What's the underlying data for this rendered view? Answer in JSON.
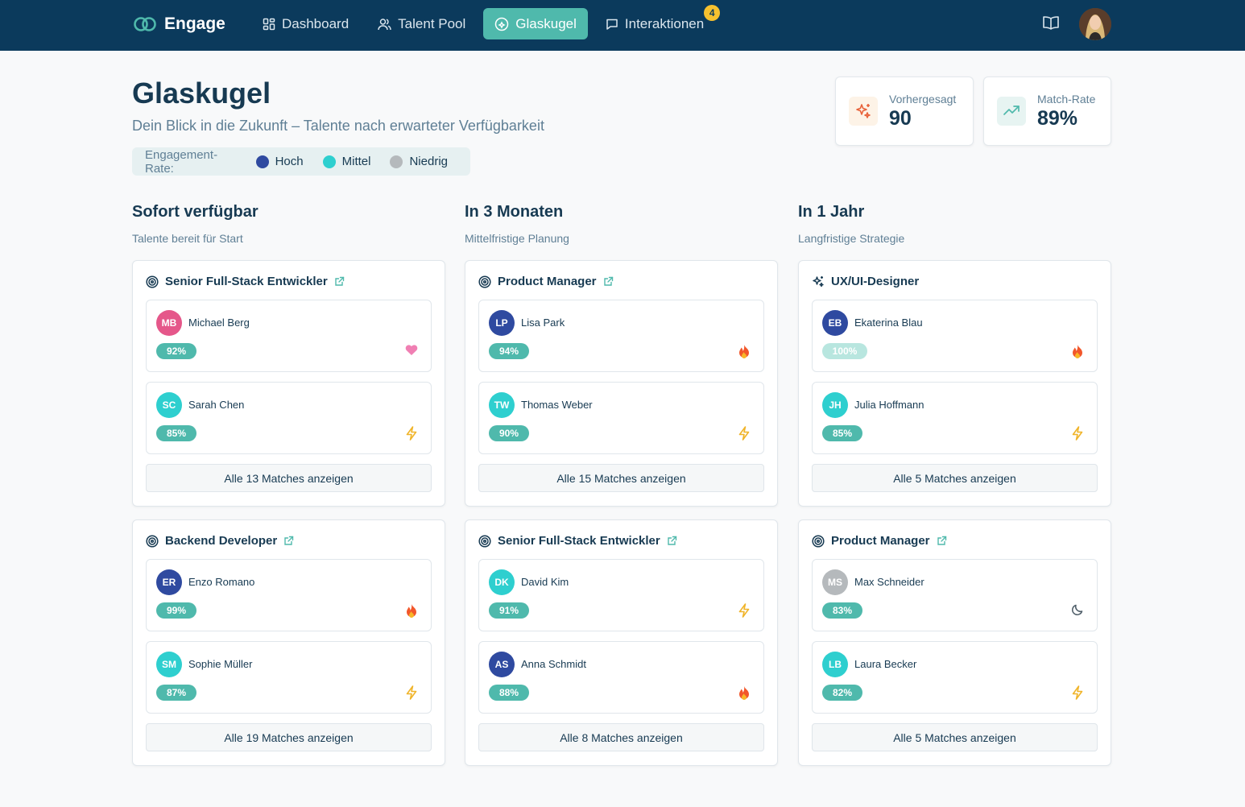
{
  "nav": {
    "brand": "Engage",
    "items": [
      {
        "label": "Dashboard",
        "icon": "grid-icon"
      },
      {
        "label": "Talent Pool",
        "icon": "users-icon"
      },
      {
        "label": "Glaskugel",
        "icon": "crystal-ball-icon",
        "active": true
      },
      {
        "label": "Interaktionen",
        "icon": "message-icon",
        "badge": "4"
      }
    ]
  },
  "header": {
    "title": "Glaskugel",
    "subtitle": "Dein Blick in die Zukunft – Talente nach erwarteter Verfügbarkeit",
    "legend": {
      "label": "Engagement-Rate:",
      "items": [
        {
          "label": "Hoch",
          "color": "#2f4aa0"
        },
        {
          "label": "Mittel",
          "color": "#2ecfcf"
        },
        {
          "label": "Niedrig",
          "color": "#b5b9bc"
        }
      ]
    }
  },
  "stats": [
    {
      "label": "Vorhergesagt",
      "value": "90",
      "icon": "sparkle-icon"
    },
    {
      "label": "Match-Rate",
      "value": "89%",
      "icon": "trending-up-icon"
    }
  ],
  "colors": {
    "high": "#2f4aa0",
    "mid": "#2ecfcf",
    "low": "#b5b9bc",
    "pink": "#e5578a",
    "accent": "#4fb9ac"
  },
  "columns": [
    {
      "title": "Sofort verfügbar",
      "subtitle": "Talente bereit für Start",
      "cards": [
        {
          "role": "Senior Full-Stack Entwickler",
          "icon": "target-icon",
          "link": true,
          "candidates": [
            {
              "initials": "MB",
              "name": "Michael Berg",
              "pct": "92%",
              "avatar": "pink",
              "indicator": "heart"
            },
            {
              "initials": "SC",
              "name": "Sarah Chen",
              "pct": "85%",
              "avatar": "mid",
              "indicator": "bolt"
            }
          ],
          "button": "Alle 13 Matches anzeigen"
        },
        {
          "role": "Backend Developer",
          "icon": "target-icon",
          "link": true,
          "candidates": [
            {
              "initials": "ER",
              "name": "Enzo Romano",
              "pct": "99%",
              "avatar": "high",
              "indicator": "flame"
            },
            {
              "initials": "SM",
              "name": "Sophie Müller",
              "pct": "87%",
              "avatar": "mid",
              "indicator": "bolt"
            }
          ],
          "button": "Alle 19 Matches anzeigen"
        }
      ]
    },
    {
      "title": "In 3 Monaten",
      "subtitle": "Mittelfristige Planung",
      "cards": [
        {
          "role": "Product Manager",
          "icon": "target-icon",
          "link": true,
          "candidates": [
            {
              "initials": "LP",
              "name": "Lisa Park",
              "pct": "94%",
              "avatar": "high",
              "indicator": "flame"
            },
            {
              "initials": "TW",
              "name": "Thomas Weber",
              "pct": "90%",
              "avatar": "mid",
              "indicator": "bolt"
            }
          ],
          "button": "Alle 15 Matches anzeigen"
        },
        {
          "role": "Senior Full-Stack Entwickler",
          "icon": "target-icon",
          "link": true,
          "candidates": [
            {
              "initials": "DK",
              "name": "David Kim",
              "pct": "91%",
              "avatar": "mid",
              "indicator": "bolt"
            },
            {
              "initials": "AS",
              "name": "Anna Schmidt",
              "pct": "88%",
              "avatar": "high",
              "indicator": "flame"
            }
          ],
          "button": "Alle 8 Matches anzeigen"
        }
      ]
    },
    {
      "title": "In 1 Jahr",
      "subtitle": "Langfristige Strategie",
      "cards": [
        {
          "role": "UX/UI-Designer",
          "icon": "sparkle-icon",
          "link": false,
          "candidates": [
            {
              "initials": "EB",
              "name": "Ekaterina Blau",
              "pct": "100%",
              "avatar": "high",
              "indicator": "flame",
              "light": true
            },
            {
              "initials": "JH",
              "name": "Julia Hoffmann",
              "pct": "85%",
              "avatar": "mid",
              "indicator": "bolt"
            }
          ],
          "button": "Alle 5 Matches anzeigen"
        },
        {
          "role": "Product Manager",
          "icon": "target-icon",
          "link": true,
          "candidates": [
            {
              "initials": "MS",
              "name": "Max Schneider",
              "pct": "83%",
              "avatar": "low",
              "indicator": "moon"
            },
            {
              "initials": "LB",
              "name": "Laura Becker",
              "pct": "82%",
              "avatar": "mid",
              "indicator": "bolt"
            }
          ],
          "button": "Alle 5 Matches anzeigen"
        }
      ]
    }
  ]
}
